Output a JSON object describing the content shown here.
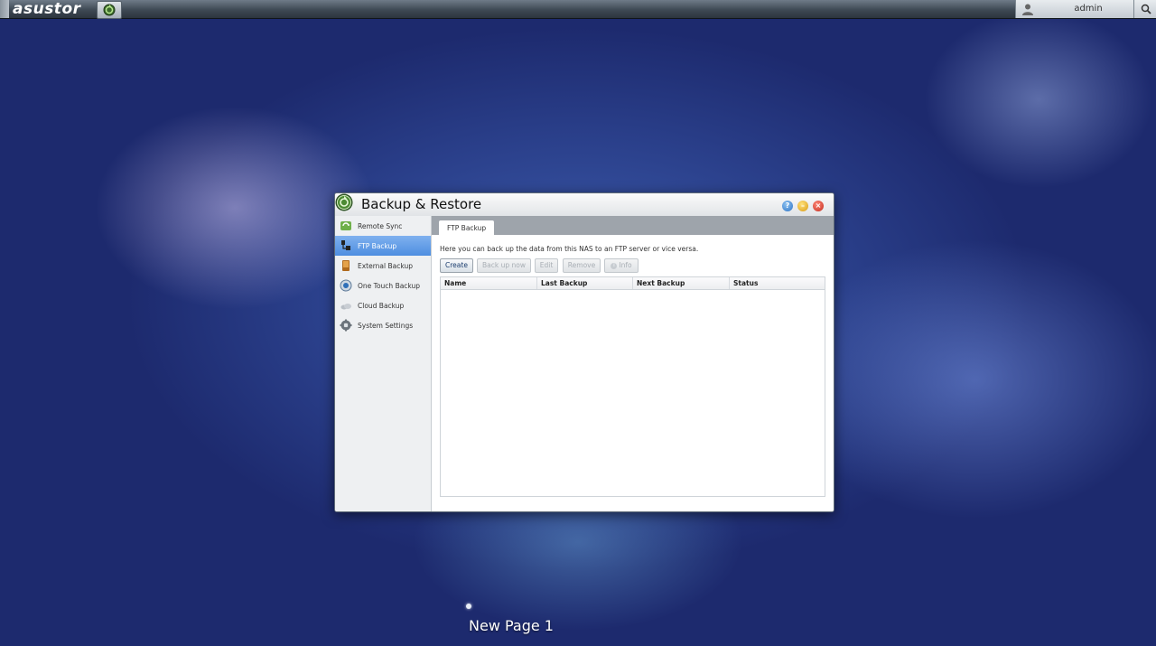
{
  "topbar": {
    "brand": "asustor",
    "user": "admin"
  },
  "window": {
    "title": "Backup & Restore",
    "controls": {
      "help": "?",
      "minimize": "–",
      "close": "×"
    }
  },
  "sidebar": {
    "items": [
      {
        "label": "Remote Sync",
        "icon": "remote-sync-icon",
        "active": false
      },
      {
        "label": "FTP Backup",
        "icon": "ftp-backup-icon",
        "active": true
      },
      {
        "label": "External Backup",
        "icon": "external-backup-icon",
        "active": false
      },
      {
        "label": "One Touch Backup",
        "icon": "one-touch-backup-icon",
        "active": false
      },
      {
        "label": "Cloud Backup",
        "icon": "cloud-backup-icon",
        "active": false
      },
      {
        "label": "System Settings",
        "icon": "system-settings-icon",
        "active": false
      }
    ]
  },
  "content": {
    "tab": "FTP Backup",
    "description": "Here you can back up the data from this NAS to an FTP server or vice versa.",
    "buttons": {
      "create": "Create",
      "backup_now": "Back up now",
      "edit": "Edit",
      "remove": "Remove",
      "info": "Info"
    },
    "table": {
      "columns": [
        "Name",
        "Last Backup",
        "Next Backup",
        "Status"
      ],
      "rows": []
    }
  },
  "desktop": {
    "page_label": "New Page 1"
  },
  "colors": {
    "accent": "#4e8ee0",
    "desktop": "#2a3f8a"
  }
}
